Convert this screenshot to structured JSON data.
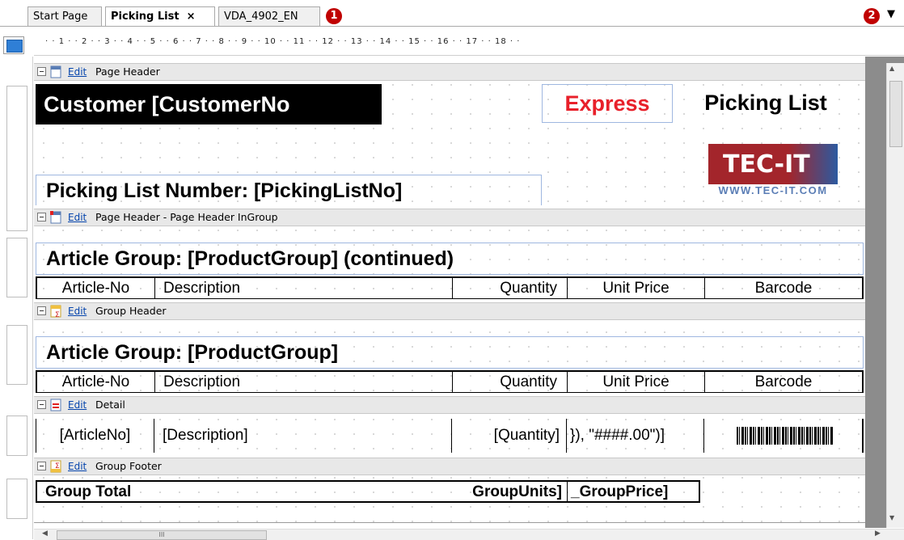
{
  "tabs": [
    {
      "label": "Start Page",
      "active": false
    },
    {
      "label": "Picking List",
      "active": true,
      "close": "×"
    },
    {
      "label": "VDA_4902_EN",
      "active": false
    }
  ],
  "badges": {
    "one": "1",
    "two": "2"
  },
  "overflow_arrow": "▼",
  "ruler": {
    "ticks": "· · 1 · · 2 · · 3 · · 4 · · 5 · · 6 · · 7 · · 8 · · 9 · · 10 · · 11 · · 12 · · 13 · · 14 · · 15 · · 16 · · 17 · · 18 · ·"
  },
  "bands": {
    "page_header": {
      "edit": "Edit",
      "title": "Page Header"
    },
    "page_header_ingroup": {
      "edit": "Edit",
      "title": "Page Header - Page Header InGroup"
    },
    "group_header": {
      "edit": "Edit",
      "title": "Group Header"
    },
    "detail": {
      "edit": "Edit",
      "title": "Detail"
    },
    "group_footer": {
      "edit": "Edit",
      "title": "Group Footer"
    }
  },
  "page_header": {
    "customer": "Customer [CustomerNo",
    "express": "Express",
    "picking_list": "Picking List",
    "picking_number": "Picking List Number: [PickingListNo]",
    "logo_main": "TEC-IT",
    "logo_url": "WWW.TEC-IT.COM"
  },
  "ingroup": {
    "article_group": "Article Group: [ProductGroup] (continued)"
  },
  "group_header": {
    "article_group": "Article Group: [ProductGroup]"
  },
  "columns": [
    "Article-No",
    "Description",
    "Quantity",
    "Unit Price",
    "Barcode"
  ],
  "detail": {
    "article": "[ArticleNo]",
    "description": "[Description]",
    "quantity": "[Quantity]",
    "unit_price": "}), \"####.00\")]"
  },
  "footer": {
    "group_total": "Group Total",
    "units": "GroupUnits]",
    "price": "_GroupPrice]"
  },
  "colors": {
    "accent_red": "#e8202a",
    "logo_red": "#b0282a",
    "logo_blue": "#2c5aa0",
    "band_bg": "#e8e8e8"
  },
  "hscroll_thumb": "III"
}
